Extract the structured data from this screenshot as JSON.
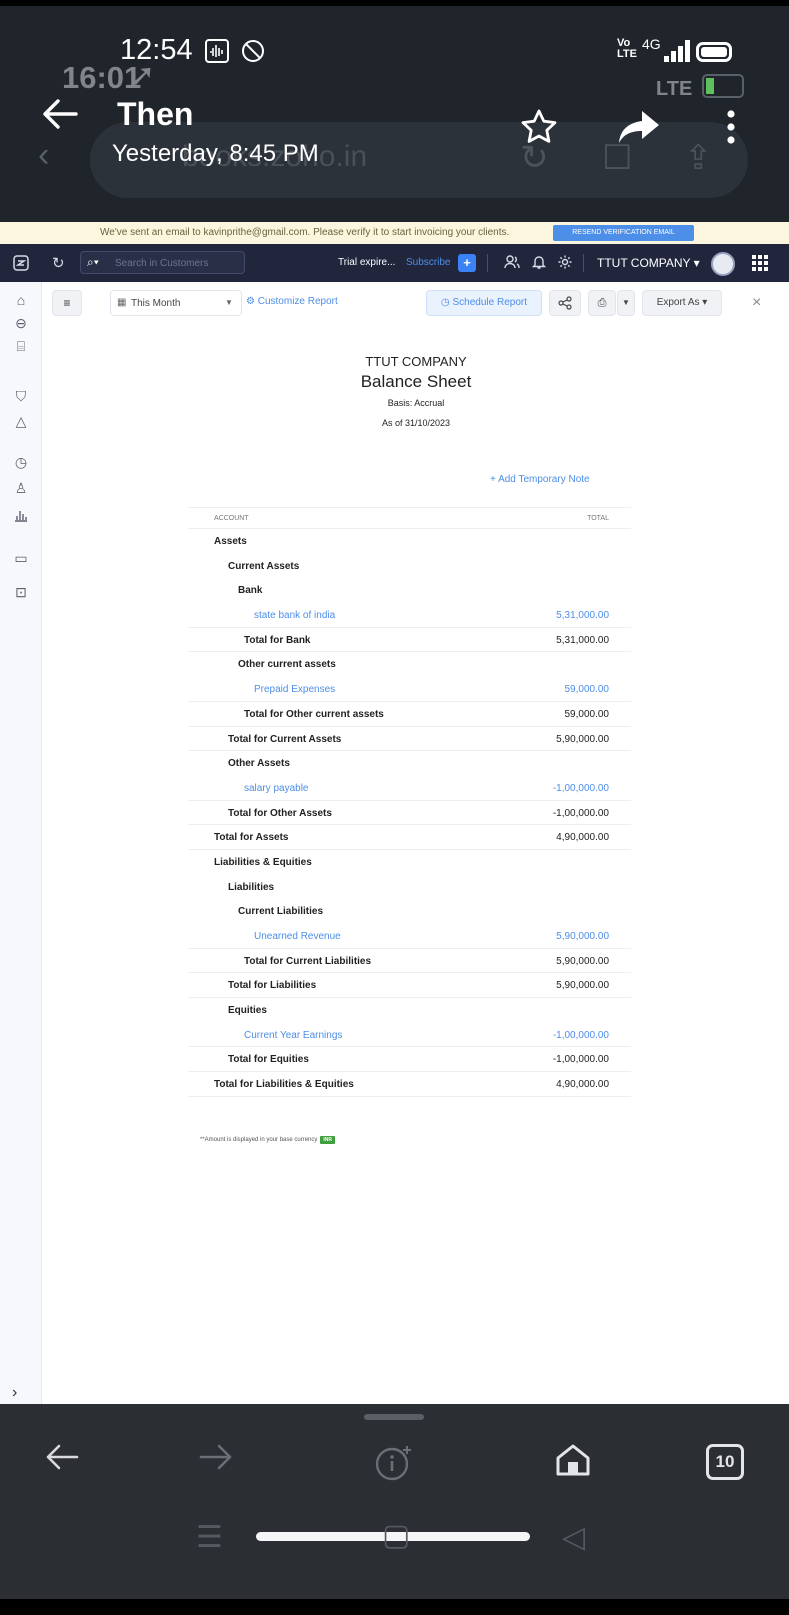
{
  "phone": {
    "time": "12:54",
    "ghost_time": "16:01",
    "volte_label": "Vo\nLTE",
    "network": "4G",
    "ghost_network": "LTE",
    "ghost_url": "books.zoho.in"
  },
  "gallery_header": {
    "title": "Then",
    "subtitle": "Yesterday, 8:45 PM"
  },
  "verify_banner": {
    "message": "We've sent an email to kavinprithe@gmail.com. Please verify it to start invoicing your clients.",
    "button": "RESEND VERIFICATION EMAIL"
  },
  "topnav": {
    "search_placeholder": "Search in Customers",
    "trial": "Trial expire...",
    "subscribe": "Subscribe",
    "plus": "+",
    "company": "TTUT COMPANY ▾"
  },
  "toolbar": {
    "period": "This Month",
    "customize": "Customize Report",
    "schedule": "Schedule Report",
    "export": "Export As"
  },
  "report": {
    "company": "TTUT COMPANY",
    "title": "Balance Sheet",
    "basis": "Basis: Accrual",
    "as_of": "As of 31/10/2023",
    "add_note": "+ Add Temporary Note",
    "col_account": "ACCOUNT",
    "col_total": "TOTAL",
    "footnote": "**Amount is displayed in your base currency",
    "currency": "INR",
    "rows": [
      {
        "label": "Assets",
        "amount": "",
        "level": 0,
        "kind": "bold"
      },
      {
        "label": "Current Assets",
        "amount": "",
        "level": 1,
        "kind": "bold"
      },
      {
        "label": "Bank",
        "amount": "",
        "level": 2,
        "kind": "bold"
      },
      {
        "label": "state bank of india",
        "amount": "5,31,000.00",
        "level": 4,
        "kind": "link"
      },
      {
        "label": "Total for Bank",
        "amount": "5,31,000.00",
        "level": 3,
        "kind": "total"
      },
      {
        "label": "Other current assets",
        "amount": "",
        "level": 2,
        "kind": "bold"
      },
      {
        "label": "Prepaid Expenses",
        "amount": "59,000.00",
        "level": 4,
        "kind": "link"
      },
      {
        "label": "Total for Other current assets",
        "amount": "59,000.00",
        "level": 3,
        "kind": "total"
      },
      {
        "label": "Total for Current Assets",
        "amount": "5,90,000.00",
        "level": 1,
        "kind": "total"
      },
      {
        "label": "Other Assets",
        "amount": "",
        "level": 1,
        "kind": "bold"
      },
      {
        "label": "salary payable",
        "amount": "-1,00,000.00",
        "level": 3,
        "kind": "link"
      },
      {
        "label": "Total for Other Assets",
        "amount": "-1,00,000.00",
        "level": 1,
        "kind": "total"
      },
      {
        "label": "Total for Assets",
        "amount": "4,90,000.00",
        "level": 0,
        "kind": "total"
      },
      {
        "label": "Liabilities & Equities",
        "amount": "",
        "level": 0,
        "kind": "bold"
      },
      {
        "label": "Liabilities",
        "amount": "",
        "level": 1,
        "kind": "bold"
      },
      {
        "label": "Current Liabilities",
        "amount": "",
        "level": 2,
        "kind": "bold"
      },
      {
        "label": "Unearned Revenue",
        "amount": "5,90,000.00",
        "level": 4,
        "kind": "link"
      },
      {
        "label": "Total for Current Liabilities",
        "amount": "5,90,000.00",
        "level": 3,
        "kind": "total"
      },
      {
        "label": "Total for Liabilities",
        "amount": "5,90,000.00",
        "level": 1,
        "kind": "total"
      },
      {
        "label": "Equities",
        "amount": "",
        "level": 1,
        "kind": "bold"
      },
      {
        "label": "Current Year Earnings",
        "amount": "-1,00,000.00",
        "level": 3,
        "kind": "link"
      },
      {
        "label": "Total for Equities",
        "amount": "-1,00,000.00",
        "level": 1,
        "kind": "total"
      },
      {
        "label": "Total for Liabilities & Equities",
        "amount": "4,90,000.00",
        "level": 0,
        "kind": "total"
      }
    ]
  },
  "bottom_nav": {
    "tab_count": "10"
  },
  "colors": {
    "accent": "#4d8ee8",
    "nav_bg": "#21263c",
    "banner_bg": "#fbf6dd",
    "overlay_bg": "#20252b"
  }
}
